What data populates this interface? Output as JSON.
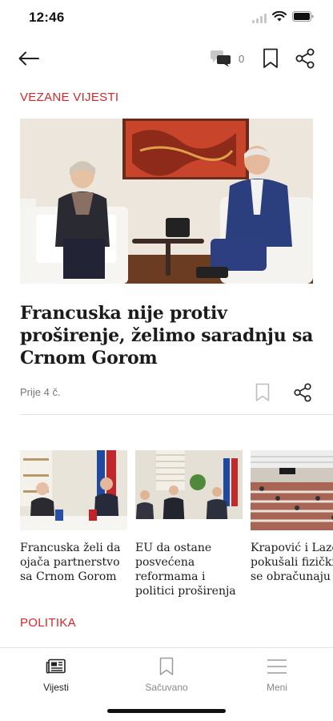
{
  "status_bar": {
    "time": "12:46"
  },
  "toolbar": {
    "comment_count": "0"
  },
  "sections": {
    "related": "VEZANE VIJESTI",
    "politics": "POLITIKA"
  },
  "article": {
    "title": "Francuska nije protiv proširenje, želimo saradnju sa Crnom Gorom",
    "time": "Prije 4 č."
  },
  "related_cards": [
    {
      "title": "Francuska želi da\nojača partnerstvo\nsa Crnom Gorom"
    },
    {
      "title": "EU da ostane\nposvećena\nreformama i\npolitici proširenja"
    },
    {
      "title": "Krapović i Lazo\npokušali fizički\nse obračunaju"
    }
  ],
  "tabbar": {
    "news": "Vijesti",
    "saved": "Sačuvano",
    "menu": "Meni"
  },
  "colors": {
    "accent": "#d4272b",
    "text": "#1b1b1b",
    "muted": "#777777"
  },
  "icons": {
    "back": "arrow-left-icon",
    "comments": "comments-icon",
    "bookmark": "bookmark-icon",
    "share": "share-icon",
    "news": "newspaper-icon",
    "menu": "hamburger-icon"
  }
}
